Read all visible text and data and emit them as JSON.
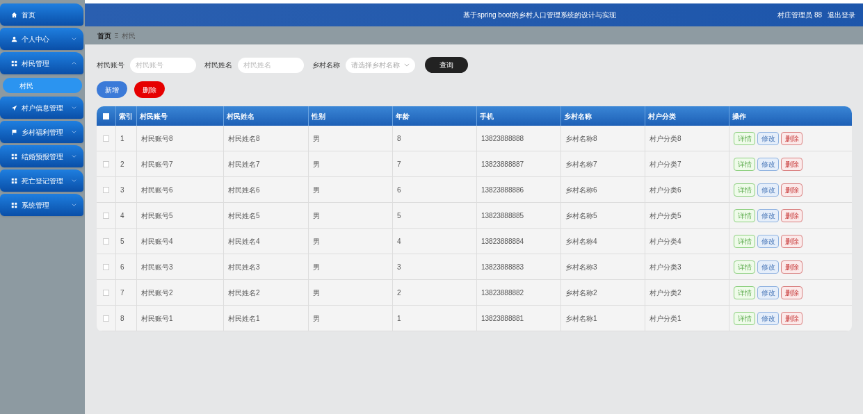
{
  "sidebar": {
    "items": [
      {
        "label": "首页",
        "kind": "home"
      },
      {
        "label": "个人中心",
        "kind": "user",
        "expanded": false
      },
      {
        "label": "村民管理",
        "kind": "grid",
        "expanded": true,
        "children": [
          {
            "label": "村民",
            "selected": true
          }
        ]
      },
      {
        "label": "村户信息管理",
        "kind": "plane",
        "expanded": false
      },
      {
        "label": "乡村福利管理",
        "kind": "flag",
        "expanded": false
      },
      {
        "label": "结婚预报管理",
        "kind": "grid",
        "expanded": false
      },
      {
        "label": "死亡登记管理",
        "kind": "grid",
        "expanded": false
      },
      {
        "label": "系统管理",
        "kind": "grid",
        "expanded": false
      }
    ]
  },
  "header": {
    "title": "基于spring boot的乡村人口管理系统的设计与实现",
    "user": "村庄管理员 88",
    "logout": "退出登录"
  },
  "breadcrumb": [
    "首页",
    "村民"
  ],
  "search": {
    "fields": [
      {
        "label": "村民账号",
        "placeholder": "村民账号",
        "kind": "input"
      },
      {
        "label": "村民姓名",
        "placeholder": "村民姓名",
        "kind": "input"
      },
      {
        "label": "乡村名称",
        "placeholder": "请选择乡村名称",
        "kind": "select"
      }
    ],
    "button": "查询"
  },
  "actions": [
    {
      "label": "新增",
      "kind": "add"
    },
    {
      "label": "删除",
      "kind": "delete"
    }
  ],
  "table": {
    "columns": [
      "索引",
      "村民账号",
      "村民姓名",
      "性别",
      "年龄",
      "手机",
      "乡村名称",
      "村户分类",
      "操作"
    ],
    "header_checked": false,
    "rows": [
      {
        "checked": false,
        "cells": [
          "1",
          "村民账号8",
          "村民姓名8",
          "男",
          "8",
          "13823888888",
          "乡村名称8",
          "村户分类8"
        ],
        "buttons": [
          {
            "label": "详情",
            "kind": "detail"
          },
          {
            "label": "修改",
            "kind": "edit"
          },
          {
            "label": "删除",
            "kind": "delete"
          }
        ]
      },
      {
        "checked": false,
        "cells": [
          "2",
          "村民账号7",
          "村民姓名7",
          "男",
          "7",
          "13823888887",
          "乡村名称7",
          "村户分类7"
        ],
        "buttons": [
          {
            "label": "详情",
            "kind": "detail"
          },
          {
            "label": "修改",
            "kind": "edit"
          },
          {
            "label": "删除",
            "kind": "delete"
          }
        ]
      },
      {
        "checked": false,
        "cells": [
          "3",
          "村民账号6",
          "村民姓名6",
          "男",
          "6",
          "13823888886",
          "乡村名称6",
          "村户分类6"
        ],
        "buttons": [
          {
            "label": "详情",
            "kind": "detail"
          },
          {
            "label": "修改",
            "kind": "edit"
          },
          {
            "label": "删除",
            "kind": "delete"
          }
        ]
      },
      {
        "checked": false,
        "cells": [
          "4",
          "村民账号5",
          "村民姓名5",
          "男",
          "5",
          "13823888885",
          "乡村名称5",
          "村户分类5"
        ],
        "buttons": [
          {
            "label": "详情",
            "kind": "detail"
          },
          {
            "label": "修改",
            "kind": "edit"
          },
          {
            "label": "删除",
            "kind": "delete"
          }
        ]
      },
      {
        "checked": false,
        "cells": [
          "5",
          "村民账号4",
          "村民姓名4",
          "男",
          "4",
          "13823888884",
          "乡村名称4",
          "村户分类4"
        ],
        "buttons": [
          {
            "label": "详情",
            "kind": "detail"
          },
          {
            "label": "修改",
            "kind": "edit"
          },
          {
            "label": "删除",
            "kind": "delete"
          }
        ]
      },
      {
        "checked": false,
        "cells": [
          "6",
          "村民账号3",
          "村民姓名3",
          "男",
          "3",
          "13823888883",
          "乡村名称3",
          "村户分类3"
        ],
        "buttons": [
          {
            "label": "详情",
            "kind": "detail"
          },
          {
            "label": "修改",
            "kind": "edit"
          },
          {
            "label": "删除",
            "kind": "delete"
          }
        ]
      },
      {
        "checked": false,
        "cells": [
          "7",
          "村民账号2",
          "村民姓名2",
          "男",
          "2",
          "13823888882",
          "乡村名称2",
          "村户分类2"
        ],
        "buttons": [
          {
            "label": "详情",
            "kind": "detail"
          },
          {
            "label": "修改",
            "kind": "edit"
          },
          {
            "label": "删除",
            "kind": "delete"
          }
        ]
      },
      {
        "checked": false,
        "cells": [
          "8",
          "村民账号1",
          "村民姓名1",
          "男",
          "1",
          "13823888881",
          "乡村名称1",
          "村户分类1"
        ],
        "buttons": [
          {
            "label": "详情",
            "kind": "detail"
          },
          {
            "label": "修改",
            "kind": "edit"
          },
          {
            "label": "删除",
            "kind": "delete"
          }
        ]
      }
    ]
  }
}
